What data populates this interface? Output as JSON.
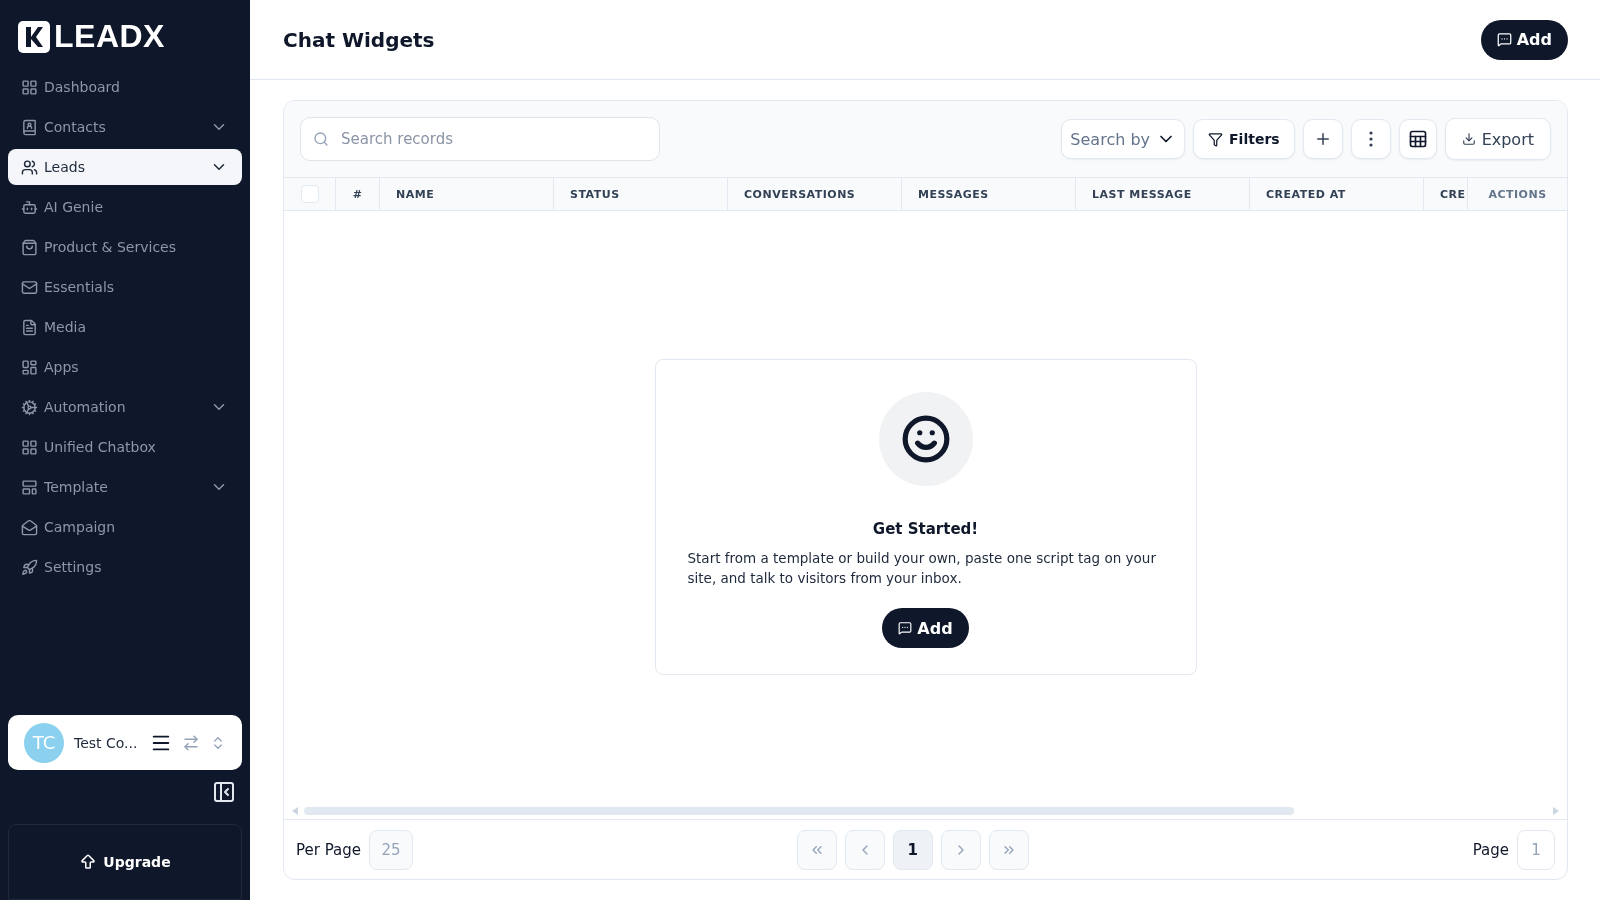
{
  "brand": {
    "name": "LEADX"
  },
  "sidebar": {
    "items": [
      {
        "label": "Dashboard",
        "selected": false
      },
      {
        "label": "Contacts",
        "selected": false,
        "expandable": true
      },
      {
        "label": "Leads",
        "selected": true,
        "expandable": true
      },
      {
        "label": "AI Genie",
        "selected": false
      },
      {
        "label": "Product & Services",
        "selected": false
      },
      {
        "label": "Essentials",
        "selected": false
      },
      {
        "label": "Media",
        "selected": false
      },
      {
        "label": "Apps",
        "selected": false
      },
      {
        "label": "Automation",
        "selected": false,
        "expandable": true
      },
      {
        "label": "Unified Chatbox",
        "selected": false
      },
      {
        "label": "Template",
        "selected": false,
        "expandable": true
      },
      {
        "label": "Campaign",
        "selected": false
      },
      {
        "label": "Settings",
        "selected": false
      }
    ],
    "account": {
      "initials": "TC",
      "name": "Test Co..."
    },
    "upgrade": "Upgrade"
  },
  "header": {
    "title": "Chat Widgets",
    "add_button": "Add"
  },
  "toolbar": {
    "search": {
      "placeholder": "Search records"
    },
    "search_by": "Search by",
    "filters": "Filters",
    "export": "Export"
  },
  "table": {
    "select_all_checked": false,
    "columns": [
      "#",
      "NAME",
      "STATUS",
      "CONVERSATIONS",
      "MESSAGES",
      "LAST MESSAGE",
      "CREATED AT",
      "CRE"
    ],
    "actions_column": "ACTIONS"
  },
  "empty_state": {
    "title": "Get Started!",
    "text": "Start from a template or build your own, paste one script tag on your site, and talk to visitors from your inbox.",
    "button": "Add"
  },
  "pagination": {
    "per_page_label": "Per Page",
    "per_page": "25",
    "current": "1",
    "page_label": "Page",
    "page_value": "1"
  }
}
